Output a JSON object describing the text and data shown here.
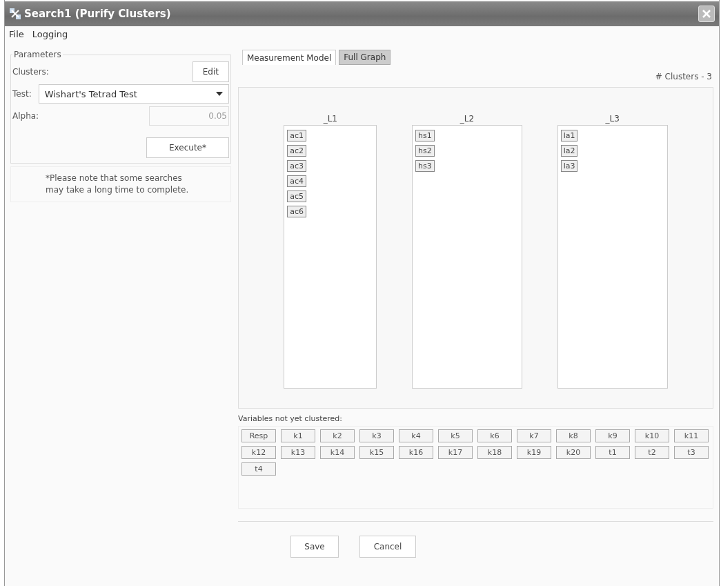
{
  "window": {
    "title": "Search1 (Purify Clusters)"
  },
  "menu": [
    "File",
    "Logging"
  ],
  "parameters": {
    "title": "Parameters",
    "clusters_label": "Clusters:",
    "edit_button": "Edit",
    "test_label": "Test:",
    "test_value": "Wishart's Tetrad Test",
    "alpha_label": "Alpha:",
    "alpha_value": "0.05",
    "execute_button": "Execute*",
    "note": "*Please note that some searches may take a long time to complete."
  },
  "tabs": [
    {
      "label": "Measurement Model",
      "selected": true
    },
    {
      "label": "Full Graph",
      "selected": false
    }
  ],
  "cluster_count": "# Clusters - 3",
  "clusters": [
    {
      "name": "_L1",
      "variables": [
        "ac1",
        "ac2",
        "ac3",
        "ac4",
        "ac5",
        "ac6"
      ]
    },
    {
      "name": "_L2",
      "variables": [
        "hs1",
        "hs2",
        "hs3"
      ]
    },
    {
      "name": "_L3",
      "variables": [
        "la1",
        "la2",
        "la3"
      ]
    }
  ],
  "unclustered": {
    "label": "Variables not yet clustered:",
    "variables": [
      "Resp",
      "k1",
      "k2",
      "k3",
      "k4",
      "k5",
      "k6",
      "k7",
      "k8",
      "k9",
      "k10",
      "k11",
      "k12",
      "k13",
      "k14",
      "k15",
      "k16",
      "k17",
      "k18",
      "k19",
      "k20",
      "t1",
      "t2",
      "t3",
      "t4"
    ]
  },
  "buttons": [
    "Save",
    "Cancel"
  ]
}
